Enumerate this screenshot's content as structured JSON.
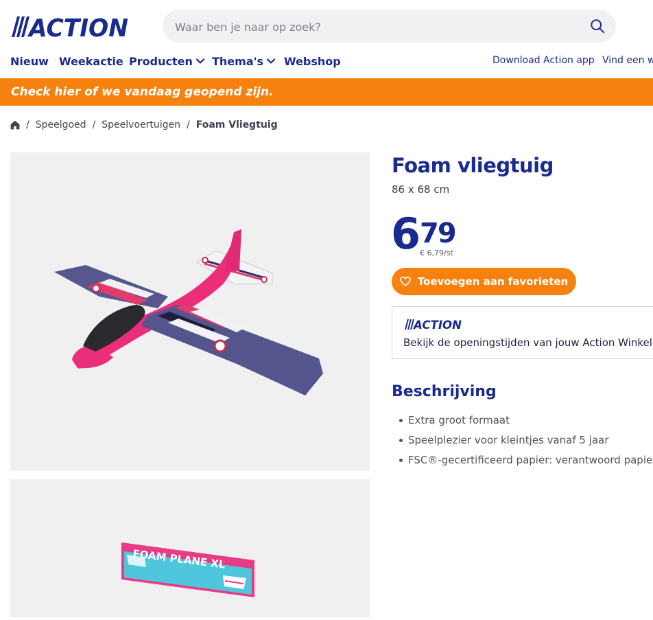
{
  "header": {
    "logo_text": "ACTION",
    "search": {
      "placeholder": "Waar ben je naar op zoek?"
    },
    "nav": [
      {
        "label": "Nieuw",
        "has_dropdown": false
      },
      {
        "label": "Weekactie",
        "has_dropdown": false
      },
      {
        "label": "Producten",
        "has_dropdown": true
      },
      {
        "label": "Thema's",
        "has_dropdown": true
      },
      {
        "label": "Webshop",
        "has_dropdown": false
      }
    ],
    "nav_right": [
      {
        "label": "Download Action app"
      },
      {
        "label": "Vind een wi"
      }
    ]
  },
  "banner": {
    "text": "Check hier of we vandaag geopend zijn."
  },
  "breadcrumb": {
    "home_icon": "home-icon",
    "items": [
      "Speelgoed",
      "Speelvoertuigen",
      "Foam Vliegtuig"
    ]
  },
  "gallery": {
    "images": [
      {
        "alt": "foam airplane",
        "icon": "airplane-image"
      },
      {
        "box_text": "FOAM PLANE XL",
        "icon": "product-box-image"
      }
    ]
  },
  "product": {
    "title": "Foam vliegtuig",
    "size": "86 x 68 cm",
    "price_int": "6",
    "price_dec": "79",
    "unit_price": "€ 6,79/st",
    "favorite_button": "Toevoegen aan favorieten",
    "favorite_icon": "heart-icon"
  },
  "store_box": {
    "logo_text": "ACTION",
    "text": "Bekijk de openingstijden van jouw Action Winkel"
  },
  "description": {
    "title": "Beschrijving",
    "items": [
      "Extra groot formaat",
      "Speelplezier voor kleintjes vanaf 5 jaar",
      "FSC®-gecertificeerd papier: verantwoord papier"
    ]
  },
  "colors": {
    "brand_blue": "#1a2b8f",
    "accent_orange": "#f7810f"
  }
}
